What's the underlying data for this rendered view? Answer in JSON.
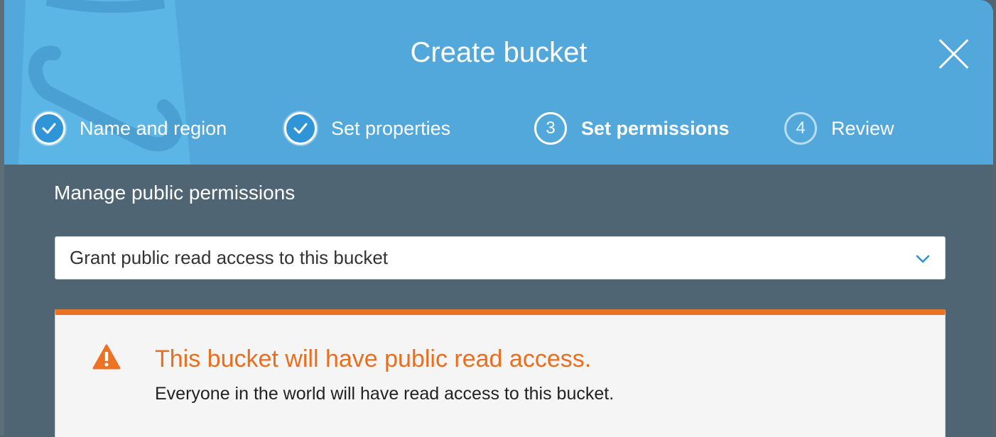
{
  "dialog": {
    "title": "Create bucket",
    "close_icon": "close-icon"
  },
  "steps": [
    {
      "number": "1",
      "label": "Name and region",
      "state": "completed",
      "icon": "check-icon"
    },
    {
      "number": "2",
      "label": "Set properties",
      "state": "completed",
      "icon": "check-icon"
    },
    {
      "number": "3",
      "label": "Set permissions",
      "state": "active"
    },
    {
      "number": "4",
      "label": "Review",
      "state": "pending"
    }
  ],
  "permissions": {
    "section_title": "Manage public permissions",
    "selected_option": "Grant public read access to this bucket",
    "dropdown_icon": "chevron-down-icon"
  },
  "alert": {
    "icon": "warning-icon",
    "heading": "This bucket will have public read access.",
    "message": "Everyone in the world will have read access to this bucket."
  },
  "colors": {
    "header": "#52a8da",
    "body": "#4f6573",
    "alert_accent": "#ec7224",
    "alert_text": "#eb6e1f",
    "chevron": "#2f8fd8"
  }
}
